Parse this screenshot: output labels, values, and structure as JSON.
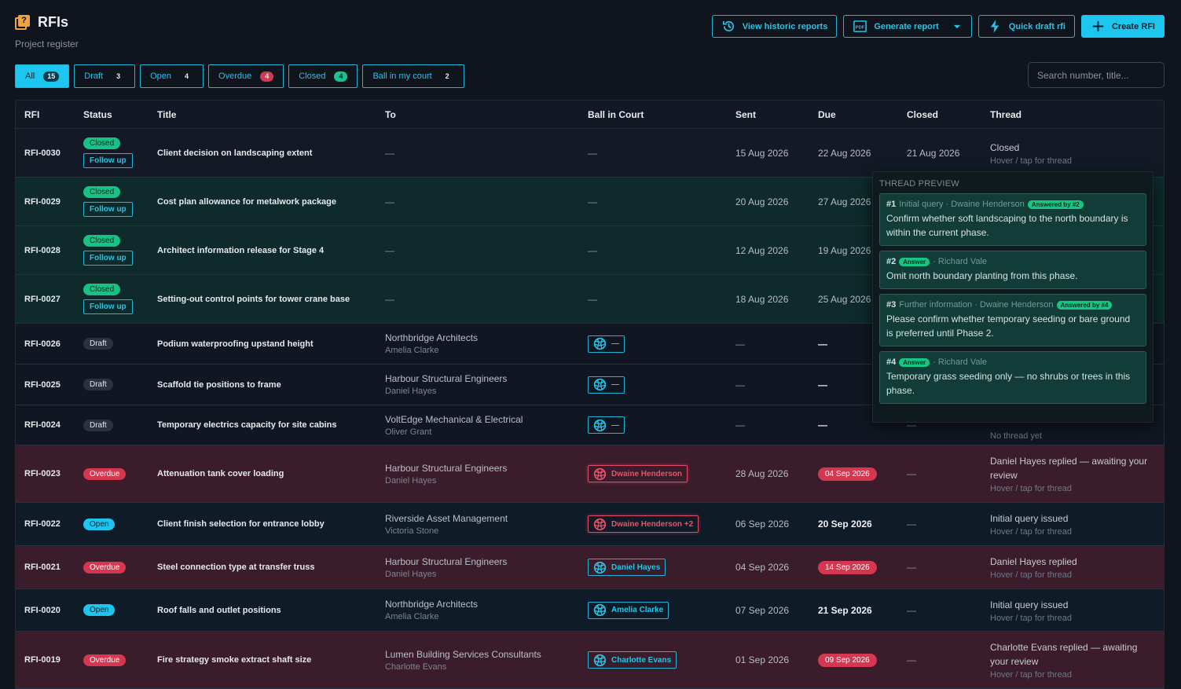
{
  "header": {
    "title": "RFIs",
    "subtitle": "Project register",
    "logo_icon": "rfi-badge-icon"
  },
  "toolbar": {
    "historic": "View historic reports",
    "generate": "Generate report",
    "quick_draft": "Quick draft rfi",
    "create": "Create RFI"
  },
  "filters": [
    {
      "label": "All",
      "count": "15"
    },
    {
      "label": "Draft",
      "count": "3"
    },
    {
      "label": "Open",
      "count": "4"
    },
    {
      "label": "Overdue",
      "count": "4"
    },
    {
      "label": "Closed",
      "count": "4"
    },
    {
      "label": "Ball in my court",
      "count": "2"
    }
  ],
  "search": {
    "placeholder": "Search number, title..."
  },
  "columns": [
    "RFI",
    "Status",
    "Title",
    "To",
    "Ball in Court",
    "Sent",
    "Due",
    "Closed",
    "Thread"
  ],
  "rows": [
    {
      "id": "RFI-0030",
      "status": "Closed",
      "follow": "Follow up",
      "title": "Client decision on landscaping extent",
      "to_co": "—",
      "to_person": "",
      "bic": "—",
      "sent": "15 Aug 2026",
      "due": "22 Aug 2026",
      "closed": "21 Aug 2026",
      "thread": "Closed",
      "thread_hint": "Hover / tap for thread"
    },
    {
      "id": "RFI-0029",
      "status": "Closed",
      "follow": "Follow up",
      "title": "Cost plan allowance for metalwork package",
      "to_co": "—",
      "to_person": "",
      "bic": "—",
      "sent": "20 Aug 2026",
      "due": "27 Aug 2026",
      "closed": "",
      "thread": "",
      "thread_hint": ""
    },
    {
      "id": "RFI-0028",
      "status": "Closed",
      "follow": "Follow up",
      "title": "Architect information release for Stage 4",
      "to_co": "—",
      "to_person": "",
      "bic": "—",
      "sent": "12 Aug 2026",
      "due": "19 Aug 2026",
      "closed": "",
      "thread": "",
      "thread_hint": ""
    },
    {
      "id": "RFI-0027",
      "status": "Closed",
      "follow": "Follow up",
      "title": "Setting-out control points for tower crane base",
      "to_co": "—",
      "to_person": "",
      "bic": "—",
      "sent": "18 Aug 2026",
      "due": "25 Aug 2026",
      "closed": "",
      "thread": "",
      "thread_hint": ""
    },
    {
      "id": "RFI-0026",
      "status": "Draft",
      "title": "Podium waterproofing upstand height",
      "to_co": "Northbridge Architects",
      "to_person": "Amelia Clarke",
      "bic": "—",
      "sent": "—",
      "due": "—",
      "closed": "",
      "thread": "",
      "thread_hint": ""
    },
    {
      "id": "RFI-0025",
      "status": "Draft",
      "title": "Scaffold tie positions to frame",
      "to_co": "Harbour Structural Engineers",
      "to_person": "Daniel Hayes",
      "bic": "—",
      "sent": "—",
      "due": "—",
      "closed": "",
      "thread": "",
      "thread_hint": ""
    },
    {
      "id": "RFI-0024",
      "status": "Draft",
      "title": "Temporary electrics capacity for site cabins",
      "to_co": "VoltEdge Mechanical & Electrical",
      "to_person": "Oliver Grant",
      "bic": "—",
      "sent": "—",
      "due": "—",
      "closed": "—",
      "thread": "No thread yet",
      "thread_hint": ""
    },
    {
      "id": "RFI-0023",
      "status": "Overdue",
      "title": "Attenuation tank cover loading",
      "to_co": "Harbour Structural Engineers",
      "to_person": "Daniel Hayes",
      "bic": "Dwaine Henderson",
      "sent": "28 Aug 2026",
      "due": "04 Sep 2026",
      "closed": "—",
      "thread": "Daniel Hayes replied — awaiting your review",
      "thread_hint": "Hover / tap for thread"
    },
    {
      "id": "RFI-0022",
      "status": "Open",
      "title": "Client finish selection for entrance lobby",
      "to_co": "Riverside Asset Management",
      "to_person": "Victoria Stone",
      "bic": "Dwaine Henderson +2",
      "sent": "06 Sep 2026",
      "due": "20 Sep 2026",
      "closed": "—",
      "thread": "Initial query issued",
      "thread_hint": "Hover / tap for thread"
    },
    {
      "id": "RFI-0021",
      "status": "Overdue",
      "title": "Steel connection type at transfer truss",
      "to_co": "Harbour Structural Engineers",
      "to_person": "Daniel Hayes",
      "bic": "Daniel Hayes",
      "sent": "04 Sep 2026",
      "due": "14 Sep 2026",
      "closed": "—",
      "thread": "Daniel Hayes replied",
      "thread_hint": "Hover / tap for thread"
    },
    {
      "id": "RFI-0020",
      "status": "Open",
      "title": "Roof falls and outlet positions",
      "to_co": "Northbridge Architects",
      "to_person": "Amelia Clarke",
      "bic": "Amelia Clarke",
      "sent": "07 Sep 2026",
      "due": "21 Sep 2026",
      "closed": "—",
      "thread": "Initial query issued",
      "thread_hint": "Hover / tap for thread"
    },
    {
      "id": "RFI-0019",
      "status": "Overdue",
      "title": "Fire strategy smoke extract shaft size",
      "to_co": "Lumen Building Services Consultants",
      "to_person": "Charlotte Evans",
      "bic": "Charlotte Evans",
      "sent": "01 Sep 2026",
      "due": "09 Sep 2026",
      "closed": "—",
      "thread": "Charlotte Evans replied — awaiting your review",
      "thread_hint": "Hover / tap for thread"
    }
  ],
  "preview": {
    "title": "THREAD PREVIEW",
    "messages": [
      {
        "num": "#1",
        "head": "Initial query · Dwaine Henderson",
        "tag": "Answered by #2",
        "body": "Confirm whether soft landscaping to the north boundary is within the current phase."
      },
      {
        "num": "#2",
        "tag_first": "Answer",
        "head": "· Richard Vale",
        "body": "Omit north boundary planting from this phase."
      },
      {
        "num": "#3",
        "head": "Further information · Dwaine Henderson",
        "tag": "Answered by #4",
        "body": "Please confirm whether temporary seeding or bare ground is preferred until Phase 2."
      },
      {
        "num": "#4",
        "tag_first": "Answer",
        "head": "· Richard Vale",
        "body": "Temporary grass seeding only — no shrubs or trees in this phase."
      }
    ]
  },
  "colors": {
    "accent": "#1cc6ee",
    "closed": "#18c285",
    "overdue": "#d4374f",
    "background": "#0f141d"
  }
}
